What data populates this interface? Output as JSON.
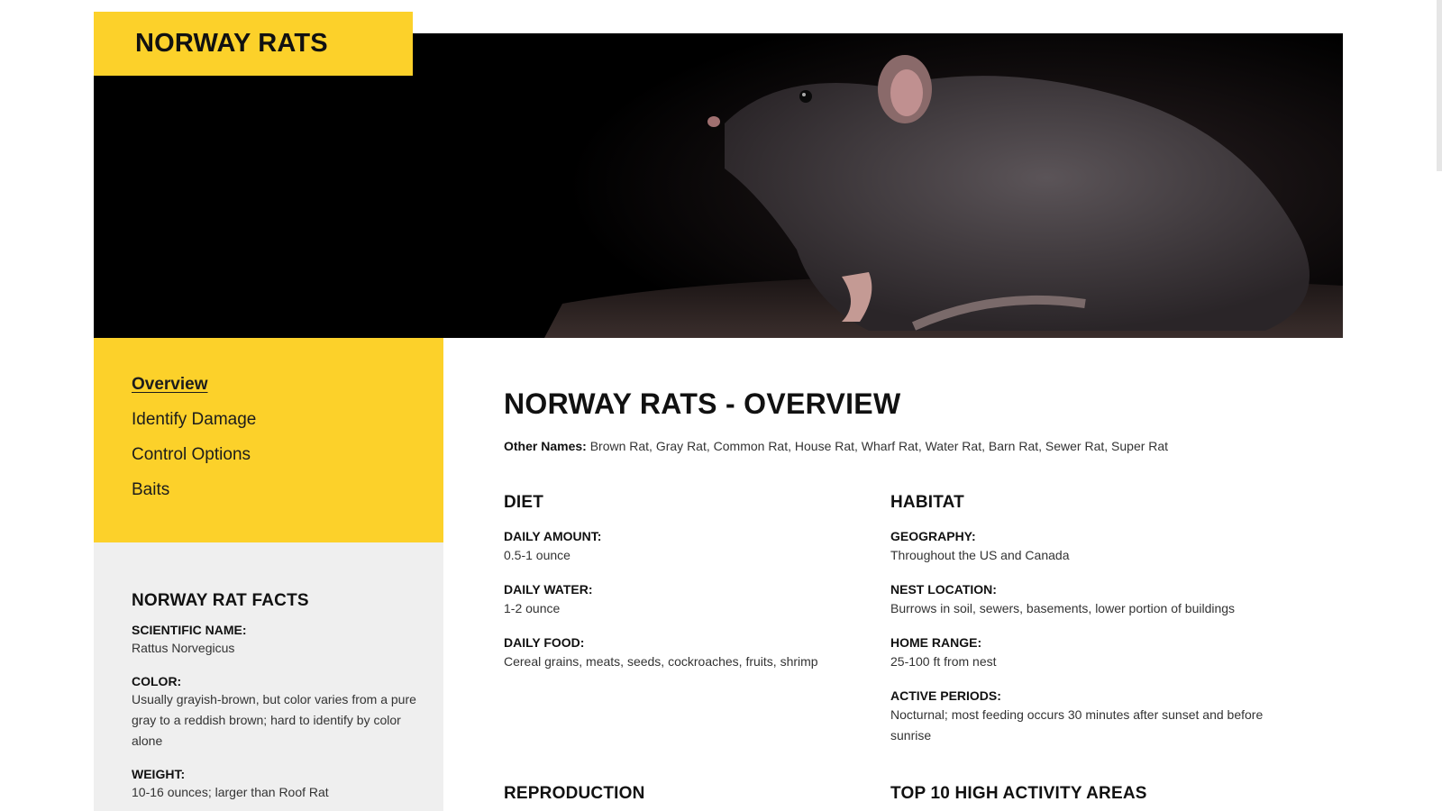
{
  "header": {
    "title": "NORWAY RATS"
  },
  "hero": {
    "image_subject": "rat-photo"
  },
  "nav": {
    "items": [
      {
        "label": "Overview",
        "active": true
      },
      {
        "label": "Identify Damage",
        "active": false
      },
      {
        "label": "Control Options",
        "active": false
      },
      {
        "label": "Baits",
        "active": false
      }
    ]
  },
  "facts": {
    "heading": "NORWAY RAT FACTS",
    "items": [
      {
        "label": "SCIENTIFIC NAME:",
        "value": "Rattus Norvegicus"
      },
      {
        "label": "COLOR:",
        "value": "Usually grayish-brown, but color varies from a pure gray to a reddish brown; hard to identify by color alone"
      },
      {
        "label": "WEIGHT:",
        "value": "10-16 ounces; larger than Roof Rat"
      }
    ]
  },
  "main": {
    "title": "NORWAY RATS - OVERVIEW",
    "other_names_label": "Other Names:",
    "other_names": " Brown Rat, Gray Rat, Common Rat, House Rat, Wharf Rat, Water Rat, Barn Rat, Sewer Rat, Super Rat"
  },
  "diet": {
    "heading": "DIET",
    "items": [
      {
        "label": "DAILY AMOUNT:",
        "value": "0.5-1 ounce"
      },
      {
        "label": "DAILY WATER:",
        "value": "1-2 ounce"
      },
      {
        "label": "DAILY FOOD:",
        "value": "Cereal grains, meats, seeds, cockroaches, fruits, shrimp"
      }
    ]
  },
  "habitat": {
    "heading": "HABITAT",
    "items": [
      {
        "label": "GEOGRAPHY:",
        "value": "Throughout the US and Canada"
      },
      {
        "label": "NEST LOCATION:",
        "value": "Burrows in soil, sewers, basements, lower portion of buildings"
      },
      {
        "label": "HOME RANGE:",
        "value": "25-100 ft from nest"
      },
      {
        "label": "ACTIVE PERIODS:",
        "value": "Nocturnal; most feeding occurs 30 minutes after sunset and before sunrise"
      }
    ]
  },
  "sections": {
    "reproduction": "REPRODUCTION",
    "top_areas": "TOP 10 HIGH ACTIVITY AREAS"
  },
  "colors": {
    "accent": "#fcd12a",
    "facts_bg": "#efefef"
  }
}
